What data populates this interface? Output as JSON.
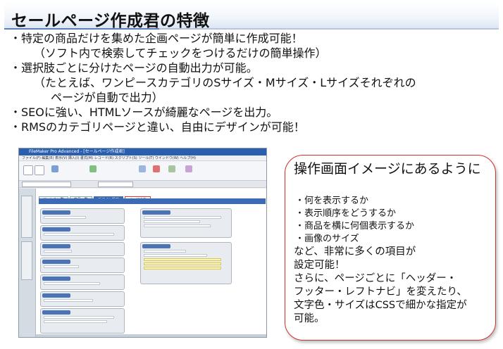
{
  "title": "セールページ作成君の特徴",
  "bullets": [
    {
      "dot": "・",
      "lines": [
        "特定の商品だけを集めた企画ページが簡単に作成可能！",
        "（ソフト内で検索してチェックをつけるだけの簡単操作）"
      ]
    },
    {
      "dot": "・",
      "lines": [
        "選択肢ごとに分けたページの自動出力が可能。",
        "（たとえば、ワンピースカテゴリのSサイズ・Mサイズ・Lサイズそれぞれの",
        "ページが自動で出力）"
      ]
    },
    {
      "dot": "・",
      "lines": [
        "SEOに強い、HTMLソースが綺麗なページを出力。"
      ]
    },
    {
      "dot": "・",
      "lines": [
        "RMSのカテゴリページと違い、自由にデザインが可能！"
      ]
    }
  ],
  "screenshot": {
    "window_title": "FileMaker Pro Advanced - [セールページ作成君]",
    "menu": "ファイル(F)  編集(E)  表示(V)  挿入(I)  書式(M)  レコード(R)  スクリプト(S)  ツール(T)  ウインドウ(W)  ヘルプ(H)",
    "tabs": [
      "ジャンル一覧",
      "商品一覧",
      "デザイン設定",
      "ページ出力"
    ]
  },
  "callout": {
    "lead": "操作画面イメージにあるように",
    "items": [
      "・何を表示するか",
      "・表示順序をどうするか",
      "・商品を横に何個表示するか",
      "・画像のサイズ"
    ],
    "tail": [
      "など、非常に多くの項目が",
      "設定可能！",
      "さらに、ページごとに「ヘッダー・",
      "フッター・レフトナビ」を変えたり、",
      "文字色・サイズはCSSで細かな指定が",
      "可能。"
    ]
  },
  "colors": {
    "callout_border": "#d0322a",
    "accent_blue": "#3b6bb5",
    "title_band": "#dde6f3"
  }
}
